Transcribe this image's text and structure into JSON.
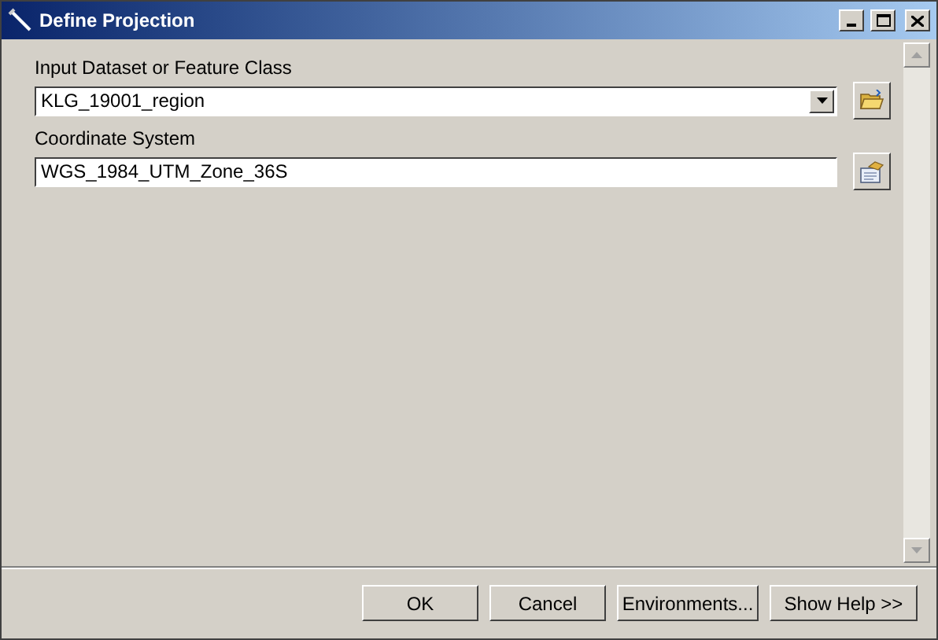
{
  "window": {
    "title": "Define Projection"
  },
  "fields": [
    {
      "label": "Input Dataset or Feature Class",
      "value": "KLG_19001_region",
      "kind": "dropdown"
    },
    {
      "label": "Coordinate System",
      "value": "WGS_1984_UTM_Zone_36S",
      "kind": "text"
    }
  ],
  "buttons": [
    "OK",
    "Cancel",
    "Environments...",
    "Show Help >>"
  ]
}
